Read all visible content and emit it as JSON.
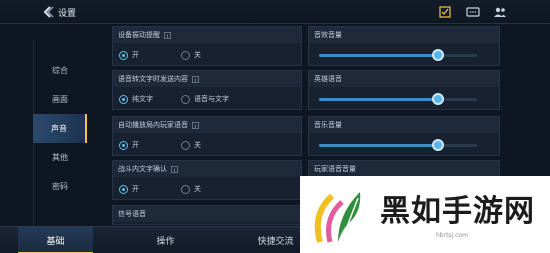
{
  "header": {
    "title": "设置"
  },
  "sidebar": {
    "items": [
      "综合",
      "画面",
      "声音",
      "其他",
      "密码"
    ],
    "active": 2
  },
  "left_panels": [
    {
      "title": "设备振动提醒",
      "options": [
        "开",
        "关"
      ],
      "selected": 0
    },
    {
      "title": "语音转文字时发送内容",
      "options": [
        "纯文字",
        "语音与文字"
      ],
      "selected": 0
    },
    {
      "title": "自动播放局内玩家语音",
      "options": [
        "开",
        "关"
      ],
      "selected": 0
    },
    {
      "title": "战斗内文字确认",
      "options": [
        "开",
        "关"
      ],
      "selected": 0
    },
    {
      "title": "信号语音"
    }
  ],
  "right_panels": [
    {
      "title": "音效音量",
      "value": 0.75
    },
    {
      "title": "英雄语音",
      "value": 0.75
    },
    {
      "title": "音乐音量",
      "value": 0.75
    },
    {
      "title": "玩家语音音量",
      "value": 0.75
    }
  ],
  "bottom_tabs": [
    {
      "label": "基础"
    },
    {
      "label": "操作"
    },
    {
      "label": "快捷交流"
    }
  ],
  "watermark": {
    "text": "黑如手游网",
    "url": "hbrtsj.com"
  },
  "colors": {
    "accent": "#5fc0e9",
    "active_tab": "#f0c548"
  }
}
